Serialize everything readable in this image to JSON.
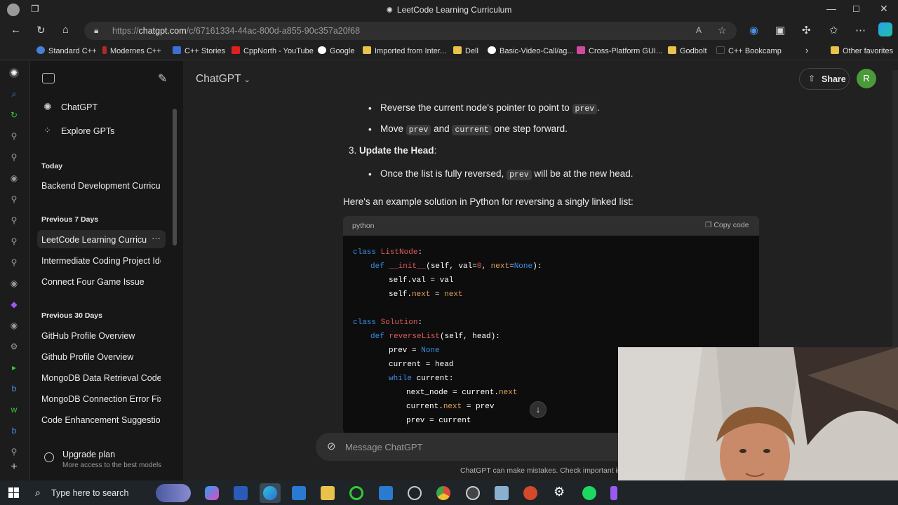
{
  "window": {
    "title": "LeetCode Learning Curriculum"
  },
  "address": {
    "url_prefix": "https://",
    "url_domain": "chatgpt.com",
    "url_path": "/c/67161334-44ac-800d-a855-90c357a20f68"
  },
  "bookmarks": [
    {
      "label": "Standard C++",
      "color": "#4a7fd6"
    },
    {
      "label": "Modernes C++",
      "color": "#b02a2a"
    },
    {
      "label": "C++ Stories",
      "color": "#3b6fd6"
    },
    {
      "label": "CppNorth - YouTube",
      "color": "#e02020"
    },
    {
      "label": "Google",
      "color": "#ffffff"
    },
    {
      "label": "Imported from Inter...",
      "color": "#e8c24a"
    },
    {
      "label": "Dell",
      "color": "#e8c24a"
    },
    {
      "label": "Basic-Video-Call/ag...",
      "color": "#ffffff"
    },
    {
      "label": "Cross-Platform GUI...",
      "color": "#d24aa0"
    },
    {
      "label": "Godbolt",
      "color": "#e8c24a"
    },
    {
      "label": "C++ Bookcamp",
      "color": "#202020"
    },
    {
      "label": "Other favorites",
      "color": "#e8c24a"
    }
  ],
  "app": {
    "model_label": "ChatGPT",
    "share_label": "Share",
    "avatar_letter": "R"
  },
  "sidebar": {
    "top": [
      {
        "label": "ChatGPT"
      },
      {
        "label": "Explore GPTs"
      }
    ],
    "today_heading": "Today",
    "today": [
      {
        "label": "Backend Development Curriculum"
      }
    ],
    "prev7_heading": "Previous 7 Days",
    "prev7": [
      {
        "label": "LeetCode Learning Curriculum"
      },
      {
        "label": "Intermediate Coding Project Ideas"
      },
      {
        "label": "Connect Four Game Issue"
      }
    ],
    "prev30_heading": "Previous 30 Days",
    "prev30": [
      {
        "label": "GitHub Profile Overview"
      },
      {
        "label": "Github Profile Overview"
      },
      {
        "label": "MongoDB Data Retrieval Code"
      },
      {
        "label": "MongoDB Connection Error Fix"
      },
      {
        "label": "Code Enhancement Suggestions"
      }
    ],
    "upgrade_title": "Upgrade plan",
    "upgrade_sub": "More access to the best models"
  },
  "content": {
    "b1_text": "Reverse the current node's pointer to point to",
    "b1_code": "prev",
    "b2_text1": "Move",
    "b2_code1": "prev",
    "b2_text2": "and",
    "b2_code2": "current",
    "b2_text3": "one step forward.",
    "step3_num": "3.",
    "step3_title": "Update the Head",
    "b3_text1": "Once the list is fully reversed,",
    "b3_code": "prev",
    "b3_text2": "will be at the new head.",
    "intro": "Here's an example solution in Python for reversing a singly linked list:",
    "code_lang": "python",
    "copy_label": "Copy code"
  },
  "composer": {
    "placeholder": "Message ChatGPT",
    "disclaimer": "ChatGPT can make mistakes. Check important info."
  },
  "taskbar": {
    "search_placeholder": "Type here to search"
  }
}
